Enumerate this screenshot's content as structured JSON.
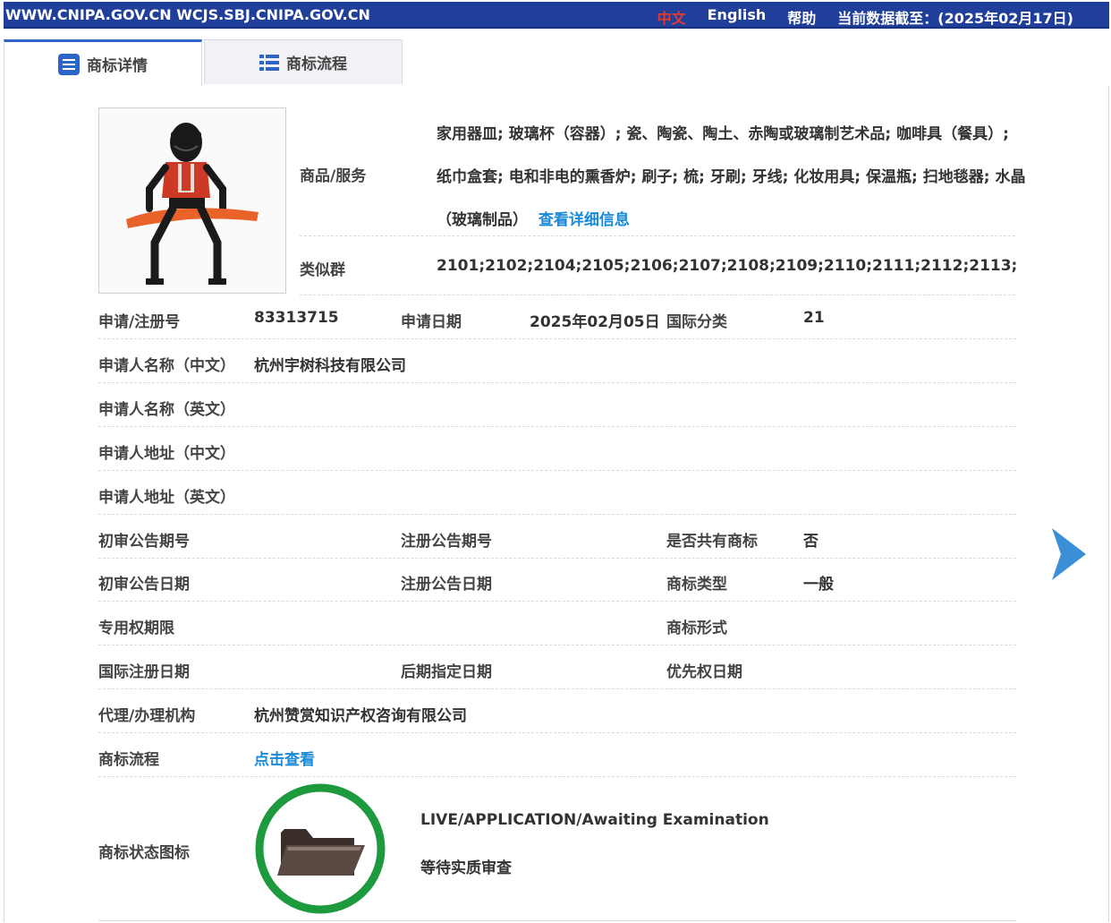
{
  "topbar": {
    "site_url": "WWW.CNIPA.GOV.CN WCJS.SBJ.CNIPA.GOV.CN",
    "lang_cn": "中文",
    "lang_en": "English",
    "help": "帮助",
    "data_as_of": "当前数据截至：(2025年02月17日)"
  },
  "tabs": [
    {
      "label": "商标详情",
      "active": true
    },
    {
      "label": "商标流程",
      "active": false
    }
  ],
  "goods": {
    "label": "商品/服务",
    "lines": [
      "家用器皿; 玻璃杯（容器）; 瓷、陶瓷、陶土、赤陶或玻璃制艺术品; 咖啡具（餐具）;",
      "纸巾盒套; 电和非电的熏香炉; 刷子; 梳; 牙刷; 牙线; 化妆用具; 保温瓶; 扫地毯器; 水晶",
      "（玻璃制品）"
    ],
    "detail_link": "查看详细信息"
  },
  "similar_group": {
    "label": "类似群",
    "value": "2101;2102;2104;2105;2106;2107;2108;2109;2110;2111;2112;2113;"
  },
  "fields": {
    "reg_no_label": "申请/注册号",
    "reg_no": "83313715",
    "app_date_label": "申请日期",
    "app_date": "2025年02月05日",
    "intl_class_label": "国际分类",
    "intl_class": "21",
    "applicant_cn_label": "申请人名称（中文）",
    "applicant_cn": "杭州宇树科技有限公司",
    "applicant_en_label": "申请人名称（英文）",
    "addr_cn_label": "申请人地址（中文）",
    "addr_en_label": "申请人地址（英文）",
    "prelim_no_label": "初审公告期号",
    "reg_notice_no_label": "注册公告期号",
    "shared_label": "是否共有商标",
    "shared": "否",
    "prelim_date_label": "初审公告日期",
    "reg_notice_date_label": "注册公告日期",
    "tm_type_label": "商标类型",
    "tm_type": "一般",
    "exclusive_label": "专用权期限",
    "tm_form_label": "商标形式",
    "intl_reg_date_label": "国际注册日期",
    "later_designation_label": "后期指定日期",
    "priority_date_label": "优先权日期",
    "agent_label": "代理/办理机构",
    "agent": "杭州赞赏知识产权咨询有限公司",
    "process_label": "商标流程",
    "process_link": "点击查看",
    "status_icon_label": "商标状态图标",
    "status_en": "LIVE/APPLICATION/Awaiting Examination",
    "status_cn": "等待实质审查"
  },
  "colors": {
    "topbar": "#1f3f9a",
    "accent_blue": "#2d64c8",
    "link_blue": "#1a8ad8",
    "lang_active_red": "#e23a2d",
    "status_ring_green": "#1e9a3e",
    "arrow_blue": "#3a8fd6"
  },
  "icons": {
    "tab_detail": "document-icon",
    "tab_process": "list-icon",
    "next": "next-arrow-icon",
    "status": "folder-icon"
  }
}
